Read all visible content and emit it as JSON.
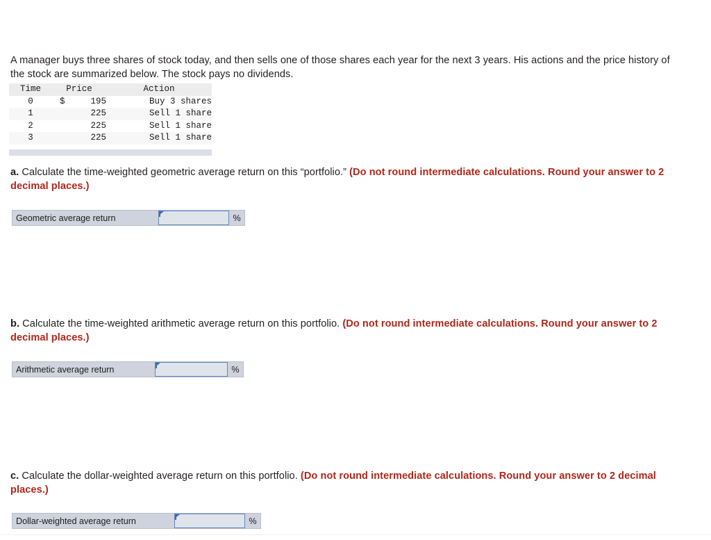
{
  "intro": {
    "text": "A manager buys three shares of stock today, and then sells one of those shares each year for the next 3 years. His actions and the price history of the stock are summarized below. The stock pays no dividends."
  },
  "stock_table": {
    "headers": [
      "Time",
      "Price",
      "Action"
    ],
    "rows": [
      {
        "time": "0",
        "currency": "$",
        "price": "195",
        "action": "Buy 3 shares"
      },
      {
        "time": "1",
        "currency": "",
        "price": "225",
        "action": "Sell 1 share"
      },
      {
        "time": "2",
        "currency": "",
        "price": "225",
        "action": "Sell 1 share"
      },
      {
        "time": "3",
        "currency": "",
        "price": "225",
        "action": "Sell 1 share"
      }
    ]
  },
  "questions": [
    {
      "label": "a.",
      "prompt": " Calculate the time-weighted geometric average return on this “portfolio.” ",
      "note": "(Do not round intermediate calculations. Round your answer to 2 decimal places.)",
      "answer": {
        "label": "Geometric average return",
        "value": "",
        "placeholder": "",
        "unit": "%"
      }
    },
    {
      "label": "b.",
      "prompt": " Calculate the time-weighted arithmetic average return on this portfolio. ",
      "note": "(Do not round intermediate calculations. Round your answer to 2 decimal places.)",
      "answer": {
        "label": "Arithmetic average return",
        "value": "",
        "placeholder": "",
        "unit": "%"
      }
    },
    {
      "label": "c.",
      "prompt": " Calculate the dollar-weighted average return on this portfolio. ",
      "note": "(Do not round intermediate calculations. Round your answer to 2 decimal places.)",
      "answer": {
        "label": "Dollar-weighted average return",
        "value": "",
        "placeholder": "",
        "unit": "%"
      }
    }
  ],
  "colors": {
    "note_red": "#b0271a",
    "answer_row_bg": "#ced3dd",
    "input_border": "#5b87c4",
    "input_bg": "#dfe3ea",
    "table_header_bg": "#ececec",
    "table_footer_bg": "#dcdfe8"
  }
}
